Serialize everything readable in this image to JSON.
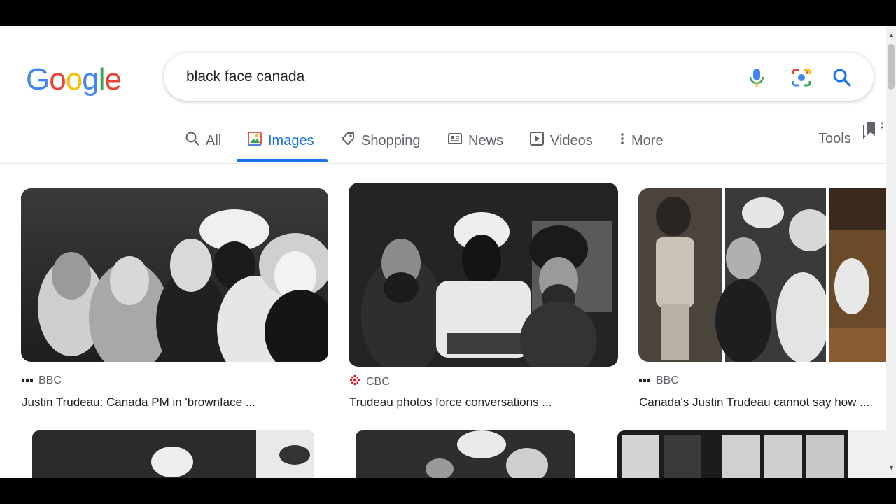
{
  "search": {
    "query": "black face canada"
  },
  "logo": {
    "letters": [
      "G",
      "o",
      "o",
      "g",
      "l",
      "e"
    ],
    "colors": [
      "#4285F4",
      "#EA4335",
      "#FBBC05",
      "#4285F4",
      "#34A853",
      "#EA4335"
    ]
  },
  "icons": {
    "mic": "microphone-icon",
    "lens": "camera-lens-icon",
    "search": "search-icon"
  },
  "tabs": [
    {
      "label": "All",
      "icon": "search-icon",
      "active": false
    },
    {
      "label": "Images",
      "icon": "image-icon",
      "active": true
    },
    {
      "label": "Shopping",
      "icon": "tag-icon",
      "active": false
    },
    {
      "label": "News",
      "icon": "newspaper-icon",
      "active": false
    },
    {
      "label": "Videos",
      "icon": "play-icon",
      "active": false
    },
    {
      "label": "More",
      "icon": "more-vertical-icon",
      "active": false
    }
  ],
  "tools_label": "Tools",
  "results": [
    {
      "source": "BBC",
      "caption": "Justin Trudeau: Canada PM in 'brownface ..."
    },
    {
      "source": "CBC",
      "caption": "Trudeau photos force conversations ..."
    },
    {
      "source": "BBC",
      "caption": "Canada's Justin Trudeau cannot say how ..."
    }
  ],
  "colors": {
    "accent": "#1a73e8",
    "text": "#202124",
    "muted": "#5f6368",
    "cbc_red": "#d1202f"
  }
}
